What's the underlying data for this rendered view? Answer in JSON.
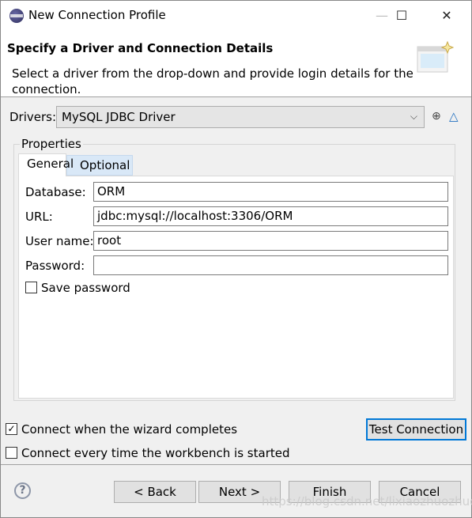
{
  "window": {
    "title": "New Connection Profile",
    "minimize": "—",
    "maximize": "☐",
    "close": "✕"
  },
  "header": {
    "title": "Specify a Driver and Connection Details",
    "description": "Select a driver from the drop-down and provide login details for the connection."
  },
  "drivers": {
    "label": "Drivers:",
    "selected": "MySQL JDBC Driver",
    "chevron": "⌵"
  },
  "properties": {
    "label": "Properties",
    "tabs": [
      {
        "label": "General",
        "active": true
      },
      {
        "label": "Optional",
        "active": false
      }
    ],
    "fields": [
      {
        "label": "Database:",
        "value": "ORM"
      },
      {
        "label": "URL:",
        "value": "jdbc:mysql://localhost:3306/ORM"
      },
      {
        "label": "User name:",
        "value": "root"
      },
      {
        "label": "Password:",
        "value": ""
      }
    ],
    "save_password": {
      "label": "Save password",
      "checked": false
    }
  },
  "options": {
    "connect_on_finish": {
      "label": "Connect when the wizard completes",
      "checked": true,
      "mark": "✓"
    },
    "connect_every_time": {
      "label": "Connect every time the workbench is started",
      "checked": false
    }
  },
  "test_connection": "Test Connection",
  "footer": {
    "help": "?",
    "back": "< Back",
    "next": "Next >",
    "finish": "Finish",
    "cancel": "Cancel"
  },
  "watermark": "https://blog.csdn.net/lixiaozhuozhuo",
  "colors": {
    "focus": "#0078d7",
    "tab_inactive": "#d9e8f7"
  }
}
